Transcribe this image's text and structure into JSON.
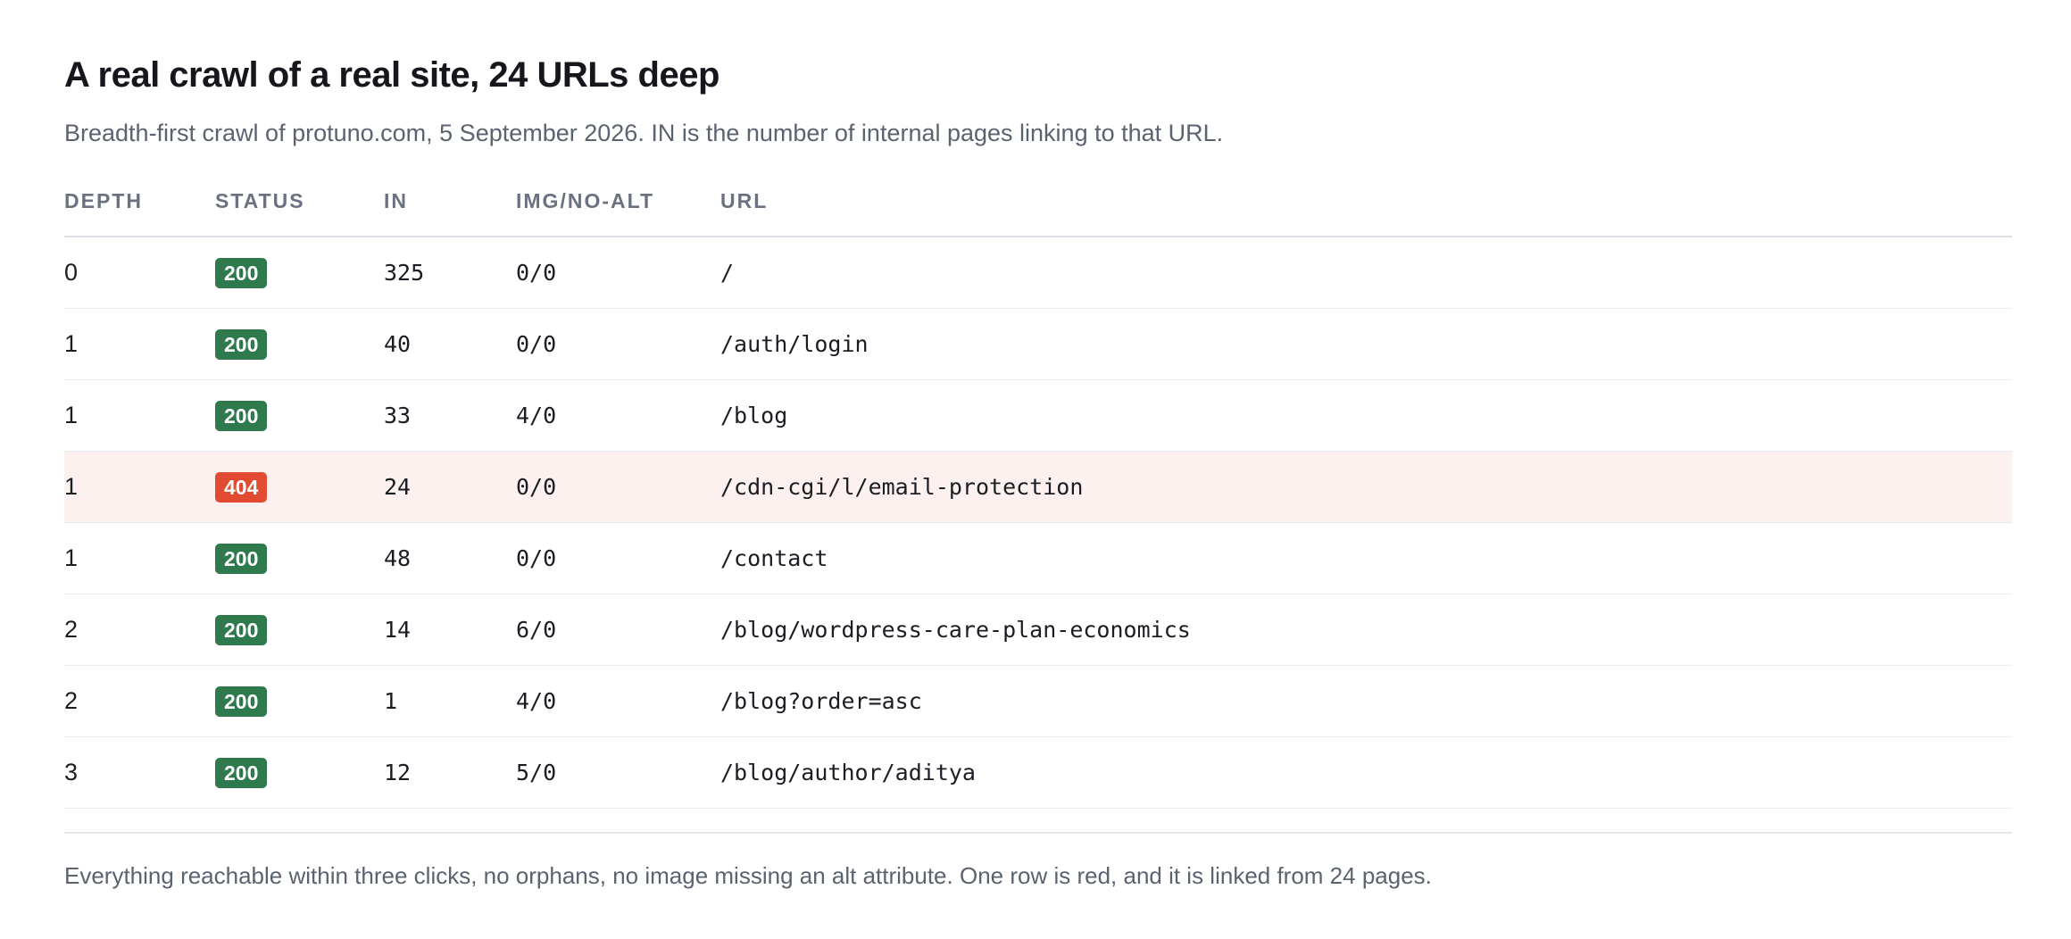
{
  "title": "A real crawl of a real site, 24 URLs deep",
  "subtitle": "Breadth-first crawl of protuno.com, 5 September 2026. IN is the number of internal pages linking to that URL.",
  "table": {
    "headers": {
      "depth": "DEPTH",
      "status": "STATUS",
      "in": "IN",
      "img": "IMG/NO-ALT",
      "url": "URL"
    },
    "rows": [
      {
        "depth": "0",
        "status": "200",
        "in": "325",
        "img": "0/0",
        "url": "/"
      },
      {
        "depth": "1",
        "status": "200",
        "in": "40",
        "img": "0/0",
        "url": "/auth/login"
      },
      {
        "depth": "1",
        "status": "200",
        "in": "33",
        "img": "4/0",
        "url": "/blog"
      },
      {
        "depth": "1",
        "status": "404",
        "in": "24",
        "img": "0/0",
        "url": "/cdn-cgi/l/email-protection"
      },
      {
        "depth": "1",
        "status": "200",
        "in": "48",
        "img": "0/0",
        "url": "/contact"
      },
      {
        "depth": "2",
        "status": "200",
        "in": "14",
        "img": "6/0",
        "url": "/blog/wordpress-care-plan-economics"
      },
      {
        "depth": "2",
        "status": "200",
        "in": "1",
        "img": "4/0",
        "url": "/blog?order=asc"
      },
      {
        "depth": "3",
        "status": "200",
        "in": "12",
        "img": "5/0",
        "url": "/blog/author/aditya"
      }
    ]
  },
  "footer": "Everything reachable within three clicks, no orphans, no image missing an alt attribute. One row is red, and it is linked from 24 pages.",
  "colors": {
    "status_ok": "#2f7a4d",
    "status_error": "#e24a32",
    "error_row_background": "#fdf1ef"
  }
}
